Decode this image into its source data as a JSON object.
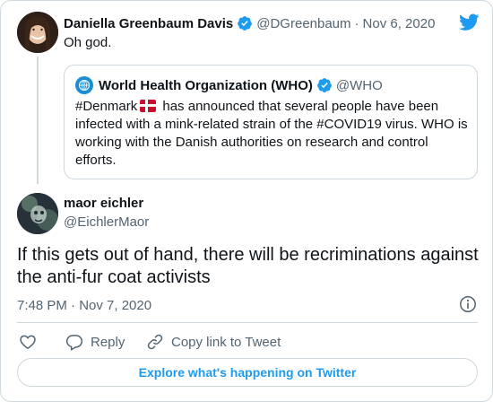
{
  "colors": {
    "accent": "#1d9bf0",
    "text": "#0f1419",
    "secondary": "#536471",
    "border": "#cfd9de"
  },
  "parent_tweet": {
    "author_name": "Daniella Greenbaum Davis",
    "handle": "@DGreenbaum",
    "separator": "·",
    "date": "Nov 6, 2020",
    "text": "Oh god."
  },
  "quoted_tweet": {
    "author_name": "World Health Organization (WHO)",
    "handle": "@WHO",
    "text_before_flag": "#Denmark",
    "text_after_flag": " has announced that several people have been infected with a mink-related strain of the #COVID19 virus. WHO is working with the Danish authorities on research and control efforts."
  },
  "main_tweet": {
    "author_name": "maor eichler",
    "handle": "@EichlerMaor",
    "text": "If this gets out of hand, there will be recriminations against the anti-fur coat activists",
    "timestamp": "7:48 PM · Nov 7, 2020"
  },
  "actions": {
    "like_icon": "heart-icon",
    "reply_label": "Reply",
    "copy_link_label": "Copy link to Tweet"
  },
  "explore_label": "Explore what's happening on Twitter"
}
